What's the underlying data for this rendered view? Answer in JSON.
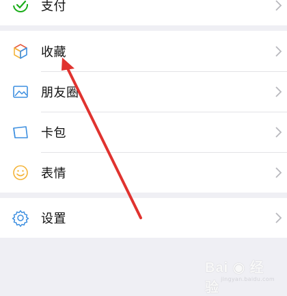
{
  "menu": {
    "pay": {
      "label": "支付",
      "icon": "payment-check-icon"
    },
    "favorites": {
      "label": "收藏",
      "icon": "cube-icon"
    },
    "moments": {
      "label": "朋友圈",
      "icon": "image-icon"
    },
    "cards": {
      "label": "卡包",
      "icon": "card-wallet-icon"
    },
    "stickers": {
      "label": "表情",
      "icon": "smiley-icon"
    },
    "settings": {
      "label": "设置",
      "icon": "gear-icon"
    }
  },
  "annotation": {
    "type": "red-arrow",
    "target": "favorites",
    "color": "#e0332f"
  },
  "watermark": {
    "brand": "Bai",
    "suffix": "经验",
    "url": "jingyan.baidu.com"
  },
  "colors": {
    "background": "#efeff4",
    "row": "#ffffff",
    "text": "#111111",
    "chevron": "#b8b8bd"
  }
}
